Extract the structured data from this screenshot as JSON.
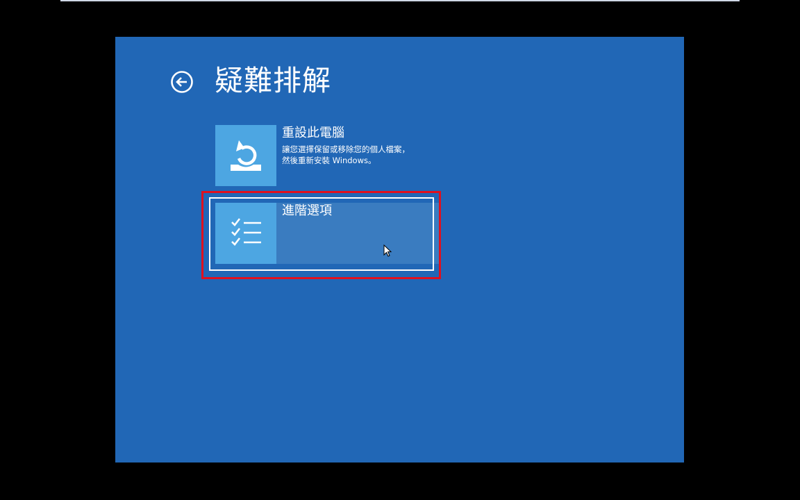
{
  "header": {
    "title": "疑難排解",
    "back_icon": "back-arrow-icon"
  },
  "options": [
    {
      "title": "重設此電腦",
      "description_line1": "讓您選擇保留或移除您的個人檔案，",
      "description_line2": "然後重新安裝 Windows。",
      "icon": "reset-pc-icon"
    },
    {
      "title": "進階選項",
      "icon": "checklist-icon"
    }
  ],
  "colors": {
    "background": "#2167b6",
    "tile": "#4da6e2",
    "highlight": "#e0101e"
  }
}
